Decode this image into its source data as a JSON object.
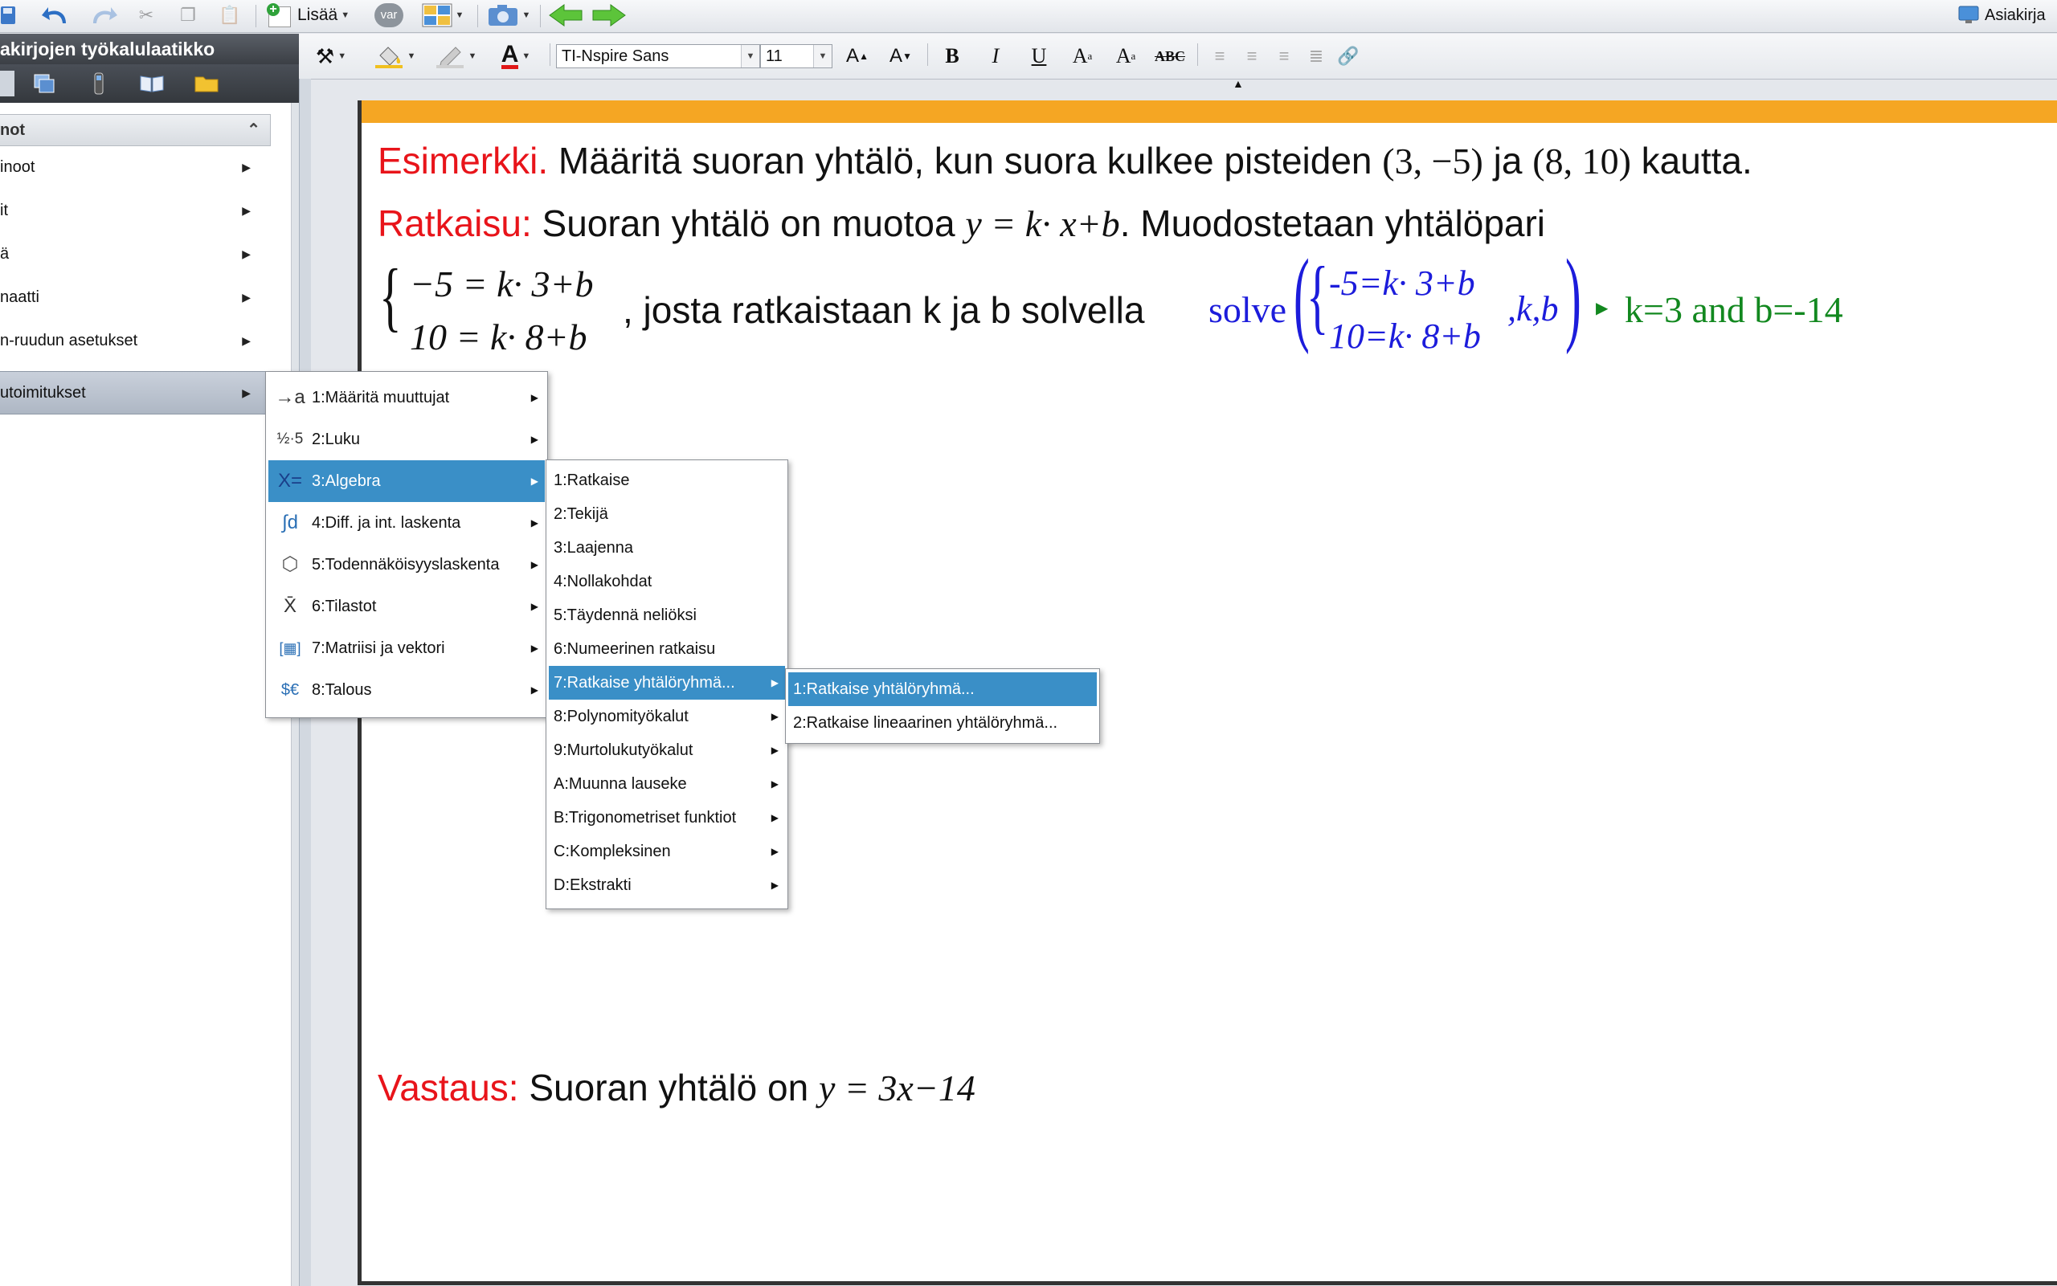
{
  "toolbar": {
    "insert_label": "Lisää",
    "var_label": "var",
    "document_label": "Asiakirja"
  },
  "format": {
    "font_name": "TI-Nspire Sans",
    "font_size": "11",
    "bold": "B",
    "italic": "I",
    "underline": "U",
    "superscript": "A",
    "subscript": "A",
    "strikethrough": "ABC"
  },
  "sidebar": {
    "title": "akirjojen työkalulaatikko",
    "section": "not",
    "items": [
      {
        "label": "inoot"
      },
      {
        "label": "it"
      },
      {
        "label": "ä"
      },
      {
        "label": "naatti"
      },
      {
        "label": "n-ruudun asetukset"
      },
      {
        "label": "utoimitukset"
      }
    ]
  },
  "document": {
    "line1": {
      "lead": "Esimerkki.",
      "text_a": " Määritä suoran yhtälö, kun suora kulkee pisteiden ",
      "p1": "(3, −5)",
      "mid": " ja ",
      "p2": "(8, 10)",
      "end": " kautta."
    },
    "line2": {
      "lead": "Ratkaisu:",
      "text_a": " Suoran yhtälö on muotoa ",
      "eq": "y = k· x+b",
      "text_b": ". Muodostetaan yhtälöpari"
    },
    "system": {
      "eq1": "−5 = k· 3+b",
      "eq2": "10 = k· 8+b",
      "text": ", josta ratkaistaan k ja b solvella",
      "solve": "solve",
      "seq1": "-5=k· 3+b",
      "seq2": "10=k· 8+b",
      "vars": ",k,b",
      "result": "k=3 and b=-14"
    },
    "answer": {
      "lead": "Vastaus:",
      "text": " Suoran yhtälö on ",
      "eq": "y = 3x−14"
    }
  },
  "menu1": [
    {
      "icon": "→a",
      "label": "1:Määritä muuttujat"
    },
    {
      "icon": "½·5",
      "label": "2:Luku"
    },
    {
      "icon": "X=",
      "label": "3:Algebra"
    },
    {
      "icon": "∫d",
      "label": "4:Diff. ja int. laskenta"
    },
    {
      "icon": "⬡",
      "label": "5:Todennäköisyyslaskenta"
    },
    {
      "icon": "X̄",
      "label": "6:Tilastot"
    },
    {
      "icon": "[▦]",
      "label": "7:Matriisi ja vektori"
    },
    {
      "icon": "$€",
      "label": "8:Talous"
    }
  ],
  "menu2": [
    {
      "label": "1:Ratkaise"
    },
    {
      "label": "2:Tekijä"
    },
    {
      "label": "3:Laajenna"
    },
    {
      "label": "4:Nollakohdat"
    },
    {
      "label": "5:Täydennä neliöksi"
    },
    {
      "label": "6:Numeerinen ratkaisu"
    },
    {
      "label": "7:Ratkaise yhtälöryhmä..."
    },
    {
      "label": "8:Polynomityökalut"
    },
    {
      "label": "9:Murtolukutyökalut"
    },
    {
      "label": "A:Muunna lauseke"
    },
    {
      "label": "B:Trigonometriset funktiot"
    },
    {
      "label": "C:Kompleksinen"
    },
    {
      "label": "D:Ekstrakti"
    }
  ],
  "menu3": [
    {
      "label": "1:Ratkaise yhtälöryhmä..."
    },
    {
      "label": "2:Ratkaise lineaarinen yhtälöryhmä..."
    }
  ],
  "colors": {
    "accent_band": "#f5a623",
    "menu_selected": "#3a8fc7",
    "heading_red": "#e8141a",
    "math_blue": "#1c1cdb",
    "result_green": "#12881f"
  }
}
